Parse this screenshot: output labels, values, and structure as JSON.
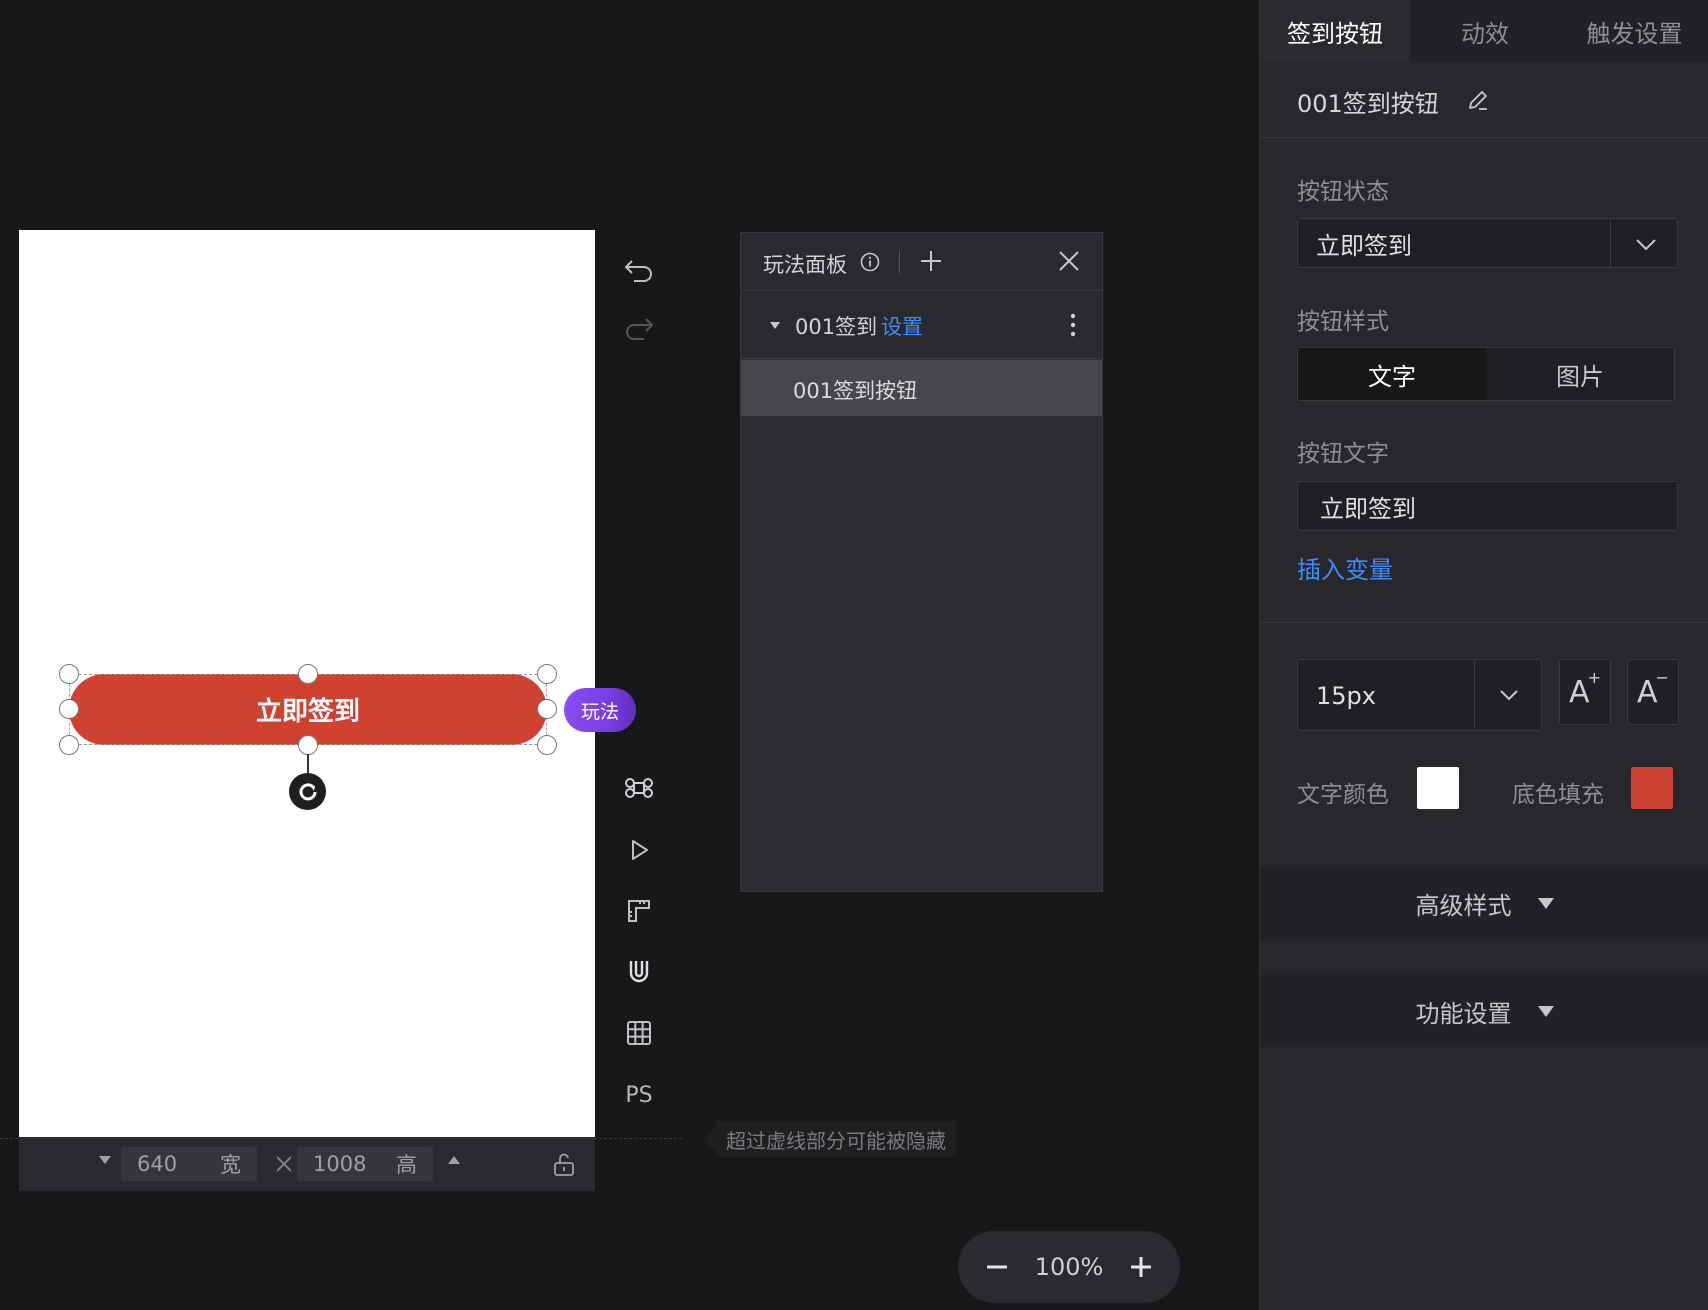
{
  "canvas": {
    "button_label": "立即签到",
    "button_color": "#cf4232",
    "play_tag": "玩法"
  },
  "sizebar": {
    "width_value": "640",
    "width_unit": "宽",
    "height_value": "1008",
    "height_unit": "高"
  },
  "tools": {
    "ps_label": "PS"
  },
  "hint": "超过虚线部分可能被隐藏",
  "zoom": {
    "value": "100%"
  },
  "gameplay_panel": {
    "title": "玩法面板",
    "group_name": "001签到",
    "group_settings_link": "设置",
    "item_label": "001签到按钮"
  },
  "right_panel": {
    "tabs": [
      {
        "label": "签到按钮",
        "active": true
      },
      {
        "label": "动效",
        "active": false
      },
      {
        "label": "触发设置",
        "active": false
      }
    ],
    "component_name": "001签到按钮",
    "state_label": "按钮状态",
    "state_value": "立即签到",
    "style_label": "按钮样式",
    "style_options": [
      "文字",
      "图片"
    ],
    "text_label": "按钮文字",
    "text_value": "立即签到",
    "insert_variable": "插入变量",
    "font_size": "15px",
    "text_color_label": "文字颜色",
    "text_color": "#ffffff",
    "fill_label": "底色填充",
    "fill_color": "#cf4232",
    "advanced_section": "高级样式",
    "function_section": "功能设置"
  }
}
